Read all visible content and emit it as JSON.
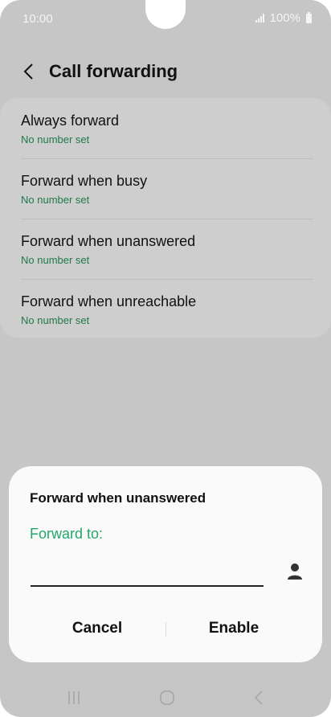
{
  "status_bar": {
    "time": "10:00",
    "battery": "100%"
  },
  "header": {
    "title": "Call forwarding",
    "back_icon": "chevron-left-icon"
  },
  "options": [
    {
      "label": "Always forward",
      "status": "No number set"
    },
    {
      "label": "Forward when busy",
      "status": "No number set"
    },
    {
      "label": "Forward when unanswered",
      "status": "No number set"
    },
    {
      "label": "Forward when unreachable",
      "status": "No number set"
    }
  ],
  "dialog": {
    "title": "Forward when unanswered",
    "field_label": "Forward to:",
    "input_value": "",
    "contact_icon": "person-icon",
    "cancel": "Cancel",
    "enable": "Enable"
  },
  "nav": {
    "recents_icon": "recents-icon",
    "home_icon": "home-icon",
    "back_icon": "back-icon"
  },
  "colors": {
    "accent_green": "#23a76a",
    "status_green": "#1e7a4a",
    "dim_background": "#c6c6c6"
  }
}
